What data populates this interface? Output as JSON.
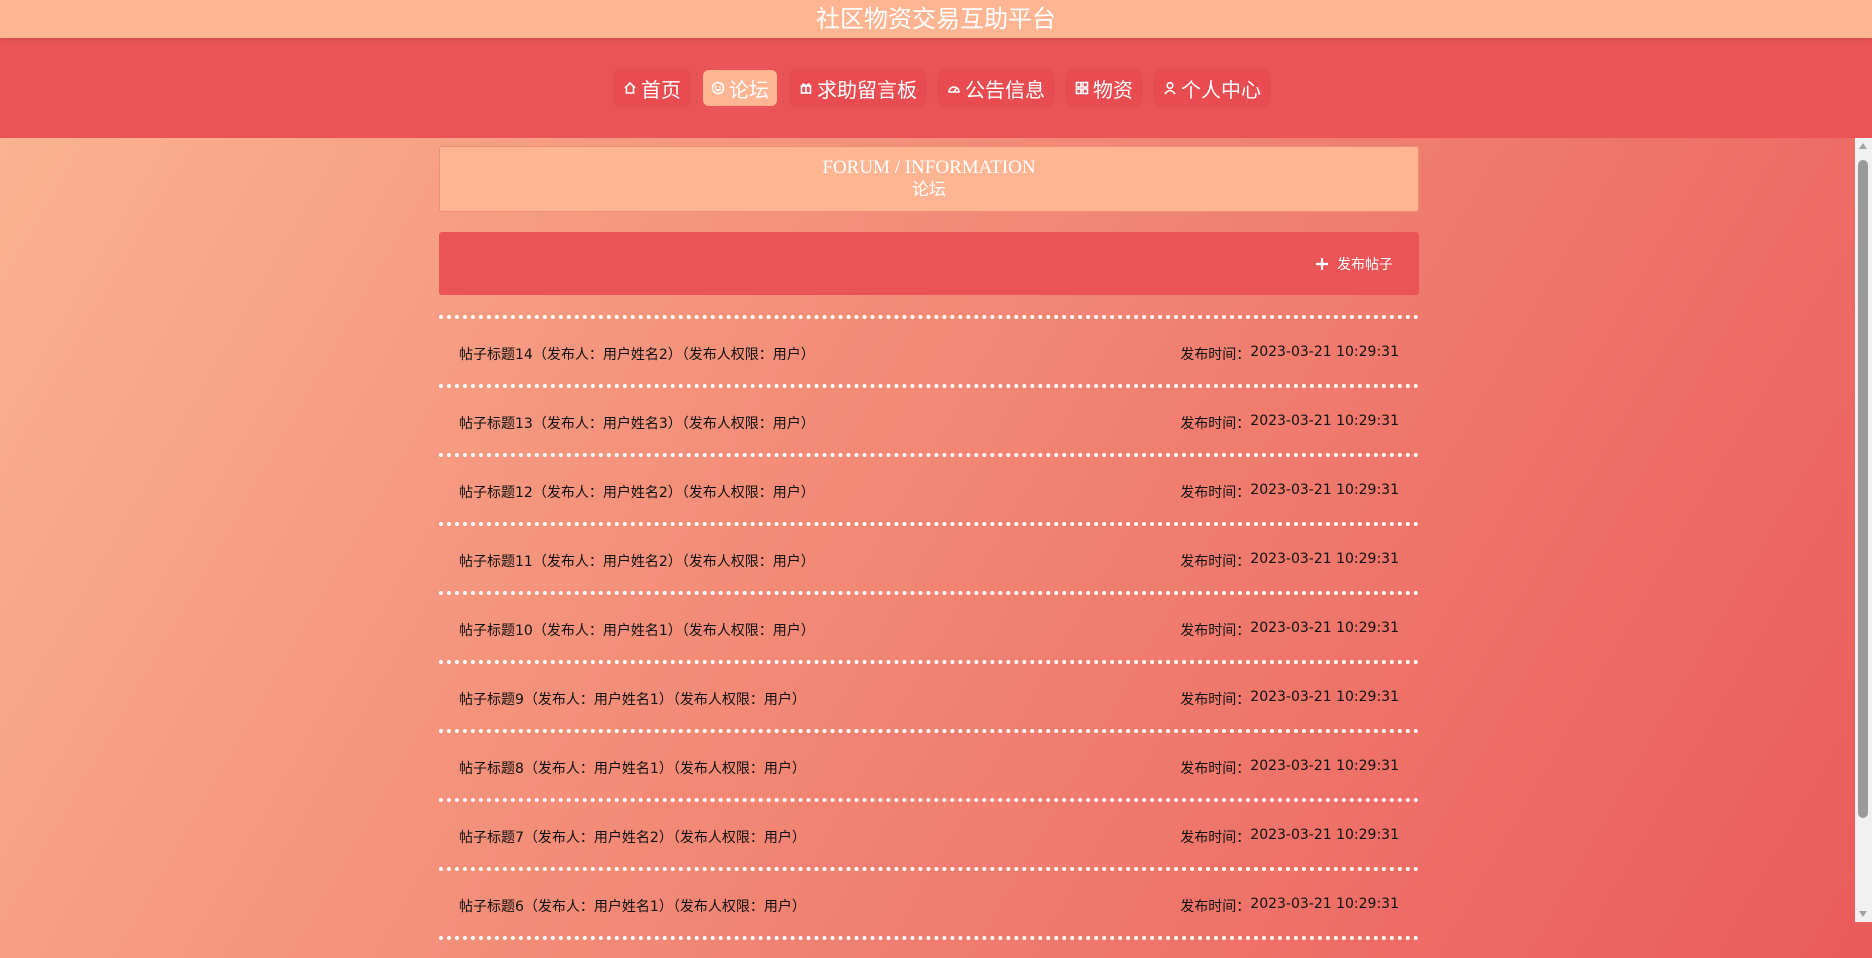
{
  "header": {
    "site_title": "社区物资交易互助平台"
  },
  "nav": {
    "items": [
      {
        "label": "首页",
        "icon": "home-icon"
      },
      {
        "label": "论坛",
        "icon": "smile-icon",
        "active": true
      },
      {
        "label": "求助留言板",
        "icon": "gift-icon"
      },
      {
        "label": "公告信息",
        "icon": "cloud-icon"
      },
      {
        "label": "物资",
        "icon": "grid-icon"
      },
      {
        "label": "个人中心",
        "icon": "user-icon"
      }
    ]
  },
  "section": {
    "title_en": "FORUM / INFORMATION",
    "title_cn": "论坛"
  },
  "actions": {
    "publish_label": "发布帖子"
  },
  "posts": [
    {
      "title": "帖子标题14（发布人：用户姓名2）（发布人权限：用户）",
      "time_label": "发布时间：",
      "time": "2023-03-21 10:29:31"
    },
    {
      "title": "帖子标题13（发布人：用户姓名3）（发布人权限：用户）",
      "time_label": "发布时间：",
      "time": "2023-03-21 10:29:31"
    },
    {
      "title": "帖子标题12（发布人：用户姓名2）（发布人权限：用户）",
      "time_label": "发布时间：",
      "time": "2023-03-21 10:29:31"
    },
    {
      "title": "帖子标题11（发布人：用户姓名2）（发布人权限：用户）",
      "time_label": "发布时间：",
      "time": "2023-03-21 10:29:31"
    },
    {
      "title": "帖子标题10（发布人：用户姓名1）（发布人权限：用户）",
      "time_label": "发布时间：",
      "time": "2023-03-21 10:29:31"
    },
    {
      "title": "帖子标题9（发布人：用户姓名1）（发布人权限：用户）",
      "time_label": "发布时间：",
      "time": "2023-03-21 10:29:31"
    },
    {
      "title": "帖子标题8（发布人：用户姓名1）（发布人权限：用户）",
      "time_label": "发布时间：",
      "time": "2023-03-21 10:29:31"
    },
    {
      "title": "帖子标题7（发布人：用户姓名2）（发布人权限：用户）",
      "time_label": "发布时间：",
      "time": "2023-03-21 10:29:31"
    },
    {
      "title": "帖子标题6（发布人：用户姓名1）（发布人权限：用户）",
      "time_label": "发布时间：",
      "time": "2023-03-21 10:29:31"
    }
  ],
  "colors": {
    "title_bar": "#ffb592",
    "nav_bar": "#ea5457",
    "active_tab": "#ffb592",
    "action_bar": "#ea5457"
  }
}
